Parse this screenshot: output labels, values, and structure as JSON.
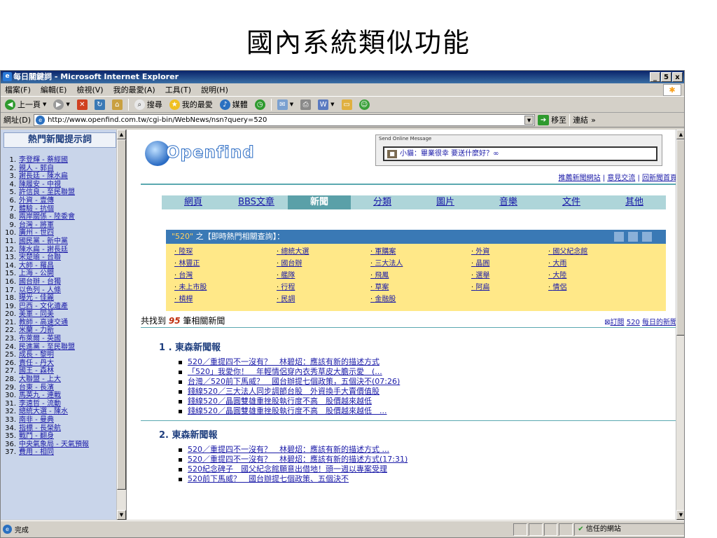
{
  "slide_title": "國內系統類似功能",
  "window": {
    "title": "每日關鍵詞 - Microsoft Internet Explorer",
    "buttons": [
      "_",
      "5",
      "x"
    ]
  },
  "menu": [
    "檔案(F)",
    "編輯(E)",
    "檢視(V)",
    "我的最愛(A)",
    "工具(T)",
    "說明(H)"
  ],
  "toolbar": {
    "back": "上一頁",
    "search": "搜尋",
    "favorites": "我的最愛",
    "media": "媒體"
  },
  "address": {
    "label": "網址(D)",
    "url": "http://www.openfind.com.tw/cgi-bin/WebNews/nsn?query=520",
    "go": "移至",
    "links": "連結"
  },
  "sidebar": {
    "title": "熱門新聞提示詞",
    "items": [
      "李登輝 - 蔡經國",
      "親人 - 郭自",
      "謝長廷 - 陳水扁",
      "陳履安 - 中視",
      "許信良 - 至民聯盟",
      "外資 - 壹傳",
      "體驗 - 抗個",
      "兩岸關係 - 陸委會",
      "台灣 - 將軍",
      "廣州 - 世四",
      "國民黨 - 新中黨",
      "陳水扁 - 謝長廷",
      "宋楚瑜 - 台聯",
      "大師 - 羅昌",
      "上海 - 公開",
      "國台辦 - 台獨",
      "以色列 - 人條",
      "曝光 - 佳麗",
      "巴西 - 文化遺產",
      "美軍 - 同美",
      "教師 - 高速交通",
      "米蘭 - 力新",
      "布萊爾 - 英國",
      "民進黨 - 至民聯盟",
      "成長 - 黎明",
      "責任 - 丹大",
      "國王 - 森林",
      "大聯盟 - 上大",
      "台東 - 長濱",
      "馬英九 - 連戰",
      "李遠哲 - 流動",
      "總統大選 - 陳水",
      "南非 - 曼典",
      "指標 - 長榮航",
      "戰鬥 - 翻身",
      "中央氣象局 - 天氣預報",
      "費用 - 相同"
    ]
  },
  "page": {
    "logo": "Openfind",
    "send_caption": "Send Online Message",
    "send_text": "小貓：畢業很幸 要送什麼好？∞",
    "top_links": [
      "推薦新聞網站",
      "意見交流",
      "回新聞首頁"
    ],
    "tabs": [
      "網頁",
      "BBS文章",
      "新聞",
      "分類",
      "圖片",
      "音樂",
      "文件",
      "其他"
    ],
    "active_tab": "新聞",
    "box_title_query": "\"520\"",
    "box_title_rest": " 之【即時熱門相關查詢】：",
    "related": [
      "陸琛",
      "總統大選",
      "軍購案",
      "外資",
      "國父紀念館",
      "林豐正",
      "國台辦",
      "三大法人",
      "晶圓",
      "大雨",
      "台灣",
      "艦隊",
      "飛鳳",
      "選舉",
      "大陸",
      "未上市股",
      "行程",
      "草案",
      "阿扁",
      "情侶",
      "槓桿",
      "民調",
      "金融股"
    ],
    "found_prefix": "共找到",
    "found_count": "95",
    "found_suffix": "筆相關新聞",
    "subscribe_prefix": "訂閱",
    "subscribe_query": "520",
    "subscribe_suffix": "每日的新聞",
    "sections": [
      {
        "title": "1 . 東森新聞報",
        "items": [
          "520／重提四不一沒有？　林碧炤：應該有新的描述方式",
          "「520」我愛你！　年輕情侶穿內衣秀草皮大膽示愛　(...",
          "台灣／520前下馬威？　國台辦提七個政策，五個決不(07:26)",
          "錢線520／三大法人同步調節台股　外資換手大賣價值股",
          "錢線520／晶圓雙雄重挫股執行度不高　股價越來越低",
          "錢線520／晶圓雙雄重挫股執行度不高　股價越來越低　..."
        ]
      },
      {
        "title": "2. 東森新聞報",
        "items": [
          "520／重提四不一沒有？　林碧炤：應該有新的描述方式 ...",
          "520／重提四不一沒有？　林碧炤：應該有新的描述方式(17:31)",
          "520紀念碑子　國父紀念館願意出借地！頭一週以專案受理",
          "520前下馬威？　國台辦提七個政策、五個決不"
        ]
      }
    ]
  },
  "status": {
    "left": "完成",
    "zone": "信任的網站"
  }
}
